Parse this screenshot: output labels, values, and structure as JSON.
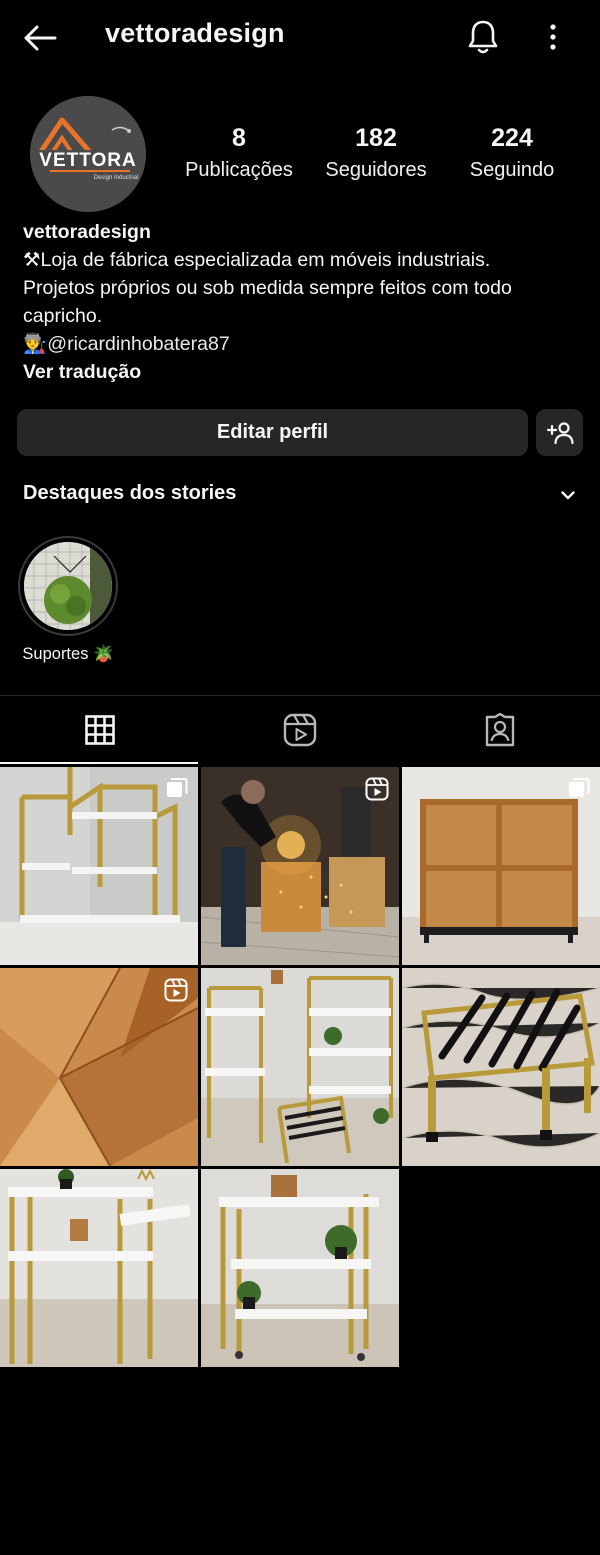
{
  "header": {
    "username": "vettoradesign",
    "back_icon": "back-arrow-icon",
    "bell_icon": "bell-icon",
    "more_icon": "more-vertical-icon"
  },
  "avatar": {
    "logo_text": "VETTORA",
    "logo_subtext": "Design Industrial",
    "accent": "#e8732a"
  },
  "stats": [
    {
      "value": "8",
      "label": "Publicações"
    },
    {
      "value": "182",
      "label": "Seguidores"
    },
    {
      "value": "224",
      "label": "Seguindo"
    }
  ],
  "bio": {
    "name": "vettoradesign",
    "line1": "⚒Loja de fábrica especializada em móveis industriais.",
    "line2": "Projetos próprios ou sob medida sempre feitos com todo",
    "line3": "capricho.",
    "mention_emoji": "👨‍🏭",
    "mention": "@ricardinhobatera87",
    "translate": "Ver tradução"
  },
  "actions": {
    "edit_profile": "Editar perfil",
    "add_user_icon": "add-user-icon"
  },
  "highlights": {
    "title": "Destaques dos stories",
    "items": [
      {
        "label": "Suportes 🪴"
      }
    ]
  },
  "tabs": [
    {
      "name": "grid",
      "icon": "grid-icon",
      "active": true
    },
    {
      "name": "reels",
      "icon": "reels-icon",
      "active": false
    },
    {
      "name": "tagged",
      "icon": "tagged-user-icon",
      "active": false
    }
  ],
  "posts": [
    {
      "badge": "carousel-icon",
      "subject": "gold frame wall shelf"
    },
    {
      "badge": "reels-icon",
      "subject": "metal cutting workshop"
    },
    {
      "badge": "carousel-icon",
      "subject": "wooden cube bookcase"
    },
    {
      "badge": "reels-icon",
      "subject": "wood panel detail"
    },
    {
      "badge": "",
      "subject": "gold shelf with bench"
    },
    {
      "badge": "",
      "subject": "gold bench black slats"
    },
    {
      "badge": "",
      "subject": "white gold shelf with crown"
    },
    {
      "badge": "",
      "subject": "gold cart shelf with plants"
    }
  ],
  "colors": {
    "background": "#000000",
    "surface": "#262626",
    "text": "#f5f5f5",
    "gold": "#b8963a"
  }
}
